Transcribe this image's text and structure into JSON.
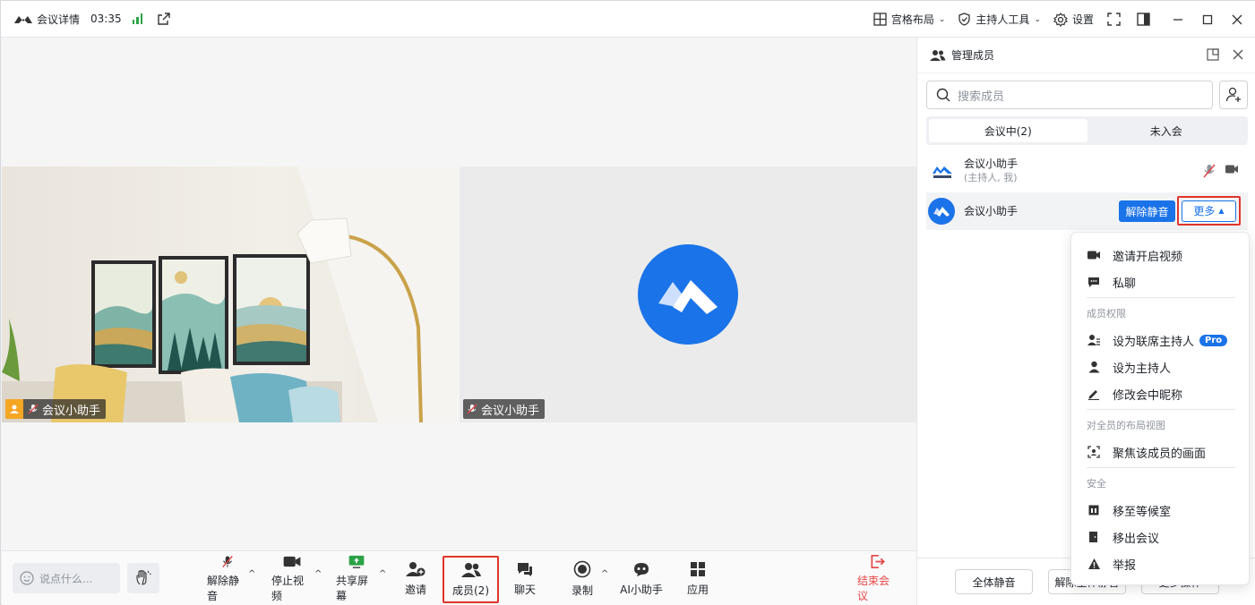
{
  "titlebar": {
    "meeting_details": "会议详情",
    "elapsed": "03:35",
    "grid_layout": "宫格布局",
    "host_tools": "主持人工具",
    "settings": "设置"
  },
  "stage": {
    "left_name": "会议小助手",
    "right_name": "会议小助手"
  },
  "toolbar": {
    "chat_placeholder": "说点什么...",
    "unmute": "解除静音",
    "stop_video": "停止视频",
    "share_screen": "共享屏幕",
    "invite": "邀请",
    "members": "成员(2)",
    "chat": "聊天",
    "record": "录制",
    "ai_assistant": "AI小助手",
    "apps": "应用",
    "end_meeting": "结束会议"
  },
  "panel": {
    "title": "管理成员",
    "search_placeholder": "搜索成员",
    "tab_in_meeting": "会议中(2)",
    "tab_not_joined": "未入会",
    "members": [
      {
        "name": "会议小助手",
        "sub": "(主持人, 我)"
      },
      {
        "name": "会议小助手"
      }
    ],
    "unmute_button": "解除静音",
    "more_button": "更多",
    "mute_all": "全体静音",
    "unmute_all": "解除全体静音",
    "more_actions": "更多操作"
  },
  "menu": {
    "invite_video": "邀请开启视频",
    "private_chat": "私聊",
    "section_permissions": "成员权限",
    "set_cohost": "设为联席主持人",
    "pro_badge": "Pro",
    "set_host": "设为主持人",
    "rename": "修改会中昵称",
    "section_layout": "对全员的布局视图",
    "focus_member": "聚焦该成员的画面",
    "section_security": "安全",
    "move_waiting": "移至等候室",
    "remove": "移出会议",
    "report": "举报"
  },
  "colors": {
    "accent": "#1a73e8",
    "highlight": "#e0352b",
    "end": "#e54545",
    "signal": "#2ba245"
  }
}
